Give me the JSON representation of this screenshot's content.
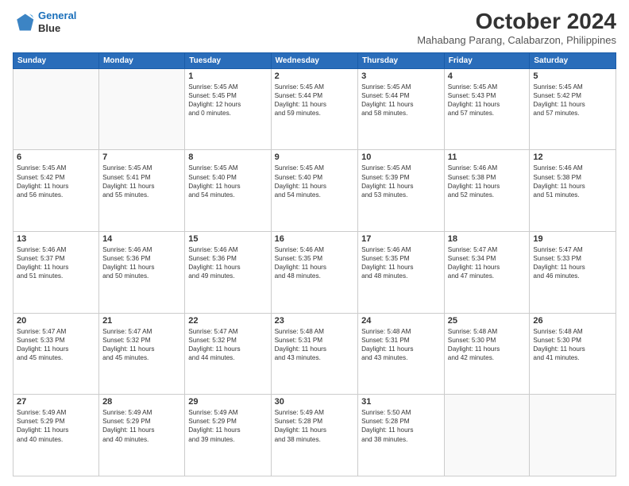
{
  "logo": {
    "line1": "General",
    "line2": "Blue"
  },
  "title": "October 2024",
  "subtitle": "Mahabang Parang, Calabarzon, Philippines",
  "headers": [
    "Sunday",
    "Monday",
    "Tuesday",
    "Wednesday",
    "Thursday",
    "Friday",
    "Saturday"
  ],
  "weeks": [
    [
      {
        "day": "",
        "info": ""
      },
      {
        "day": "",
        "info": ""
      },
      {
        "day": "1",
        "info": "Sunrise: 5:45 AM\nSunset: 5:45 PM\nDaylight: 12 hours\nand 0 minutes."
      },
      {
        "day": "2",
        "info": "Sunrise: 5:45 AM\nSunset: 5:44 PM\nDaylight: 11 hours\nand 59 minutes."
      },
      {
        "day": "3",
        "info": "Sunrise: 5:45 AM\nSunset: 5:44 PM\nDaylight: 11 hours\nand 58 minutes."
      },
      {
        "day": "4",
        "info": "Sunrise: 5:45 AM\nSunset: 5:43 PM\nDaylight: 11 hours\nand 57 minutes."
      },
      {
        "day": "5",
        "info": "Sunrise: 5:45 AM\nSunset: 5:42 PM\nDaylight: 11 hours\nand 57 minutes."
      }
    ],
    [
      {
        "day": "6",
        "info": "Sunrise: 5:45 AM\nSunset: 5:42 PM\nDaylight: 11 hours\nand 56 minutes."
      },
      {
        "day": "7",
        "info": "Sunrise: 5:45 AM\nSunset: 5:41 PM\nDaylight: 11 hours\nand 55 minutes."
      },
      {
        "day": "8",
        "info": "Sunrise: 5:45 AM\nSunset: 5:40 PM\nDaylight: 11 hours\nand 54 minutes."
      },
      {
        "day": "9",
        "info": "Sunrise: 5:45 AM\nSunset: 5:40 PM\nDaylight: 11 hours\nand 54 minutes."
      },
      {
        "day": "10",
        "info": "Sunrise: 5:45 AM\nSunset: 5:39 PM\nDaylight: 11 hours\nand 53 minutes."
      },
      {
        "day": "11",
        "info": "Sunrise: 5:46 AM\nSunset: 5:38 PM\nDaylight: 11 hours\nand 52 minutes."
      },
      {
        "day": "12",
        "info": "Sunrise: 5:46 AM\nSunset: 5:38 PM\nDaylight: 11 hours\nand 51 minutes."
      }
    ],
    [
      {
        "day": "13",
        "info": "Sunrise: 5:46 AM\nSunset: 5:37 PM\nDaylight: 11 hours\nand 51 minutes."
      },
      {
        "day": "14",
        "info": "Sunrise: 5:46 AM\nSunset: 5:36 PM\nDaylight: 11 hours\nand 50 minutes."
      },
      {
        "day": "15",
        "info": "Sunrise: 5:46 AM\nSunset: 5:36 PM\nDaylight: 11 hours\nand 49 minutes."
      },
      {
        "day": "16",
        "info": "Sunrise: 5:46 AM\nSunset: 5:35 PM\nDaylight: 11 hours\nand 48 minutes."
      },
      {
        "day": "17",
        "info": "Sunrise: 5:46 AM\nSunset: 5:35 PM\nDaylight: 11 hours\nand 48 minutes."
      },
      {
        "day": "18",
        "info": "Sunrise: 5:47 AM\nSunset: 5:34 PM\nDaylight: 11 hours\nand 47 minutes."
      },
      {
        "day": "19",
        "info": "Sunrise: 5:47 AM\nSunset: 5:33 PM\nDaylight: 11 hours\nand 46 minutes."
      }
    ],
    [
      {
        "day": "20",
        "info": "Sunrise: 5:47 AM\nSunset: 5:33 PM\nDaylight: 11 hours\nand 45 minutes."
      },
      {
        "day": "21",
        "info": "Sunrise: 5:47 AM\nSunset: 5:32 PM\nDaylight: 11 hours\nand 45 minutes."
      },
      {
        "day": "22",
        "info": "Sunrise: 5:47 AM\nSunset: 5:32 PM\nDaylight: 11 hours\nand 44 minutes."
      },
      {
        "day": "23",
        "info": "Sunrise: 5:48 AM\nSunset: 5:31 PM\nDaylight: 11 hours\nand 43 minutes."
      },
      {
        "day": "24",
        "info": "Sunrise: 5:48 AM\nSunset: 5:31 PM\nDaylight: 11 hours\nand 43 minutes."
      },
      {
        "day": "25",
        "info": "Sunrise: 5:48 AM\nSunset: 5:30 PM\nDaylight: 11 hours\nand 42 minutes."
      },
      {
        "day": "26",
        "info": "Sunrise: 5:48 AM\nSunset: 5:30 PM\nDaylight: 11 hours\nand 41 minutes."
      }
    ],
    [
      {
        "day": "27",
        "info": "Sunrise: 5:49 AM\nSunset: 5:29 PM\nDaylight: 11 hours\nand 40 minutes."
      },
      {
        "day": "28",
        "info": "Sunrise: 5:49 AM\nSunset: 5:29 PM\nDaylight: 11 hours\nand 40 minutes."
      },
      {
        "day": "29",
        "info": "Sunrise: 5:49 AM\nSunset: 5:29 PM\nDaylight: 11 hours\nand 39 minutes."
      },
      {
        "day": "30",
        "info": "Sunrise: 5:49 AM\nSunset: 5:28 PM\nDaylight: 11 hours\nand 38 minutes."
      },
      {
        "day": "31",
        "info": "Sunrise: 5:50 AM\nSunset: 5:28 PM\nDaylight: 11 hours\nand 38 minutes."
      },
      {
        "day": "",
        "info": ""
      },
      {
        "day": "",
        "info": ""
      }
    ]
  ]
}
